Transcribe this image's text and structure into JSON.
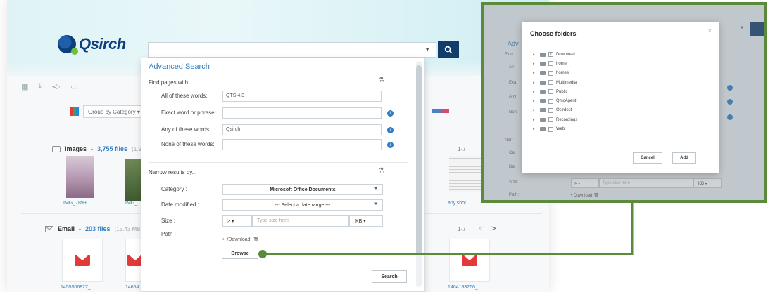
{
  "app": {
    "logo_text": "Qsirch",
    "groupby_label": "Group by Category",
    "sections": {
      "images": {
        "title": "Images",
        "count": "3,755 files",
        "meta": "(1.9 GB, 3",
        "pager": "1-7"
      },
      "email": {
        "title": "Email",
        "count": "203 files",
        "meta": "(15.43 MB, 0.3",
        "pager": "1-7",
        "prev": "<",
        "next": ">"
      }
    },
    "image_captions": [
      "IMG_7899",
      "IMG_",
      "any.shot"
    ],
    "email_captions": [
      "1455506827_",
      "14654",
      "1464183266_"
    ]
  },
  "advanced": {
    "title": "Advanced Search",
    "find_pages_with": "Find pages with...",
    "fields": [
      {
        "label": "All of these words:",
        "value": "QTS 4.3"
      },
      {
        "label": "Exact word or phrase:",
        "value": ""
      },
      {
        "label": "Any of these words:",
        "value": "Qsirch"
      },
      {
        "label": "None of these words:",
        "value": ""
      }
    ],
    "narrow_results": "Narrow results by...",
    "category_label": "Category :",
    "category_value": "Microsoft Office Documents",
    "date_label": "Date modified :",
    "date_value": "--- Select a date range ---",
    "size_label": "Size :",
    "size_op": "> ",
    "size_placeholder": "Type size here",
    "size_unit": "KB",
    "path_label": "Path :",
    "path_value": "/Download",
    "browse_label": "Browse",
    "search_label": "Search"
  },
  "inset": {
    "adv_label": "Adv",
    "modal_title": "Choose folders",
    "close": "×",
    "folders": [
      {
        "name": "Download",
        "checked": true
      },
      {
        "name": "home",
        "checked": false
      },
      {
        "name": "homes",
        "checked": false
      },
      {
        "name": "Multimedia",
        "checked": false
      },
      {
        "name": "Public",
        "checked": false
      },
      {
        "name": "QmcAgent",
        "checked": false
      },
      {
        "name": "Qsirdest",
        "checked": false
      },
      {
        "name": "Recordings",
        "checked": false
      },
      {
        "name": "Web",
        "checked": false
      }
    ],
    "cancel_label": "Cancel",
    "add_label": "Add",
    "size_placeholder": "Type size here",
    "size_unit": "KB",
    "side_labels": [
      "Find",
      "All",
      "Exa",
      "Any",
      "Non",
      "Narr",
      "Cat",
      "Dat",
      "Size:",
      "Path:"
    ],
    "path_value": "Download"
  },
  "colors": {
    "accent": "#2f7cc5",
    "navy": "#123d6b",
    "inset_border": "#5a8a3a",
    "mail_red": "#e23a3a"
  }
}
